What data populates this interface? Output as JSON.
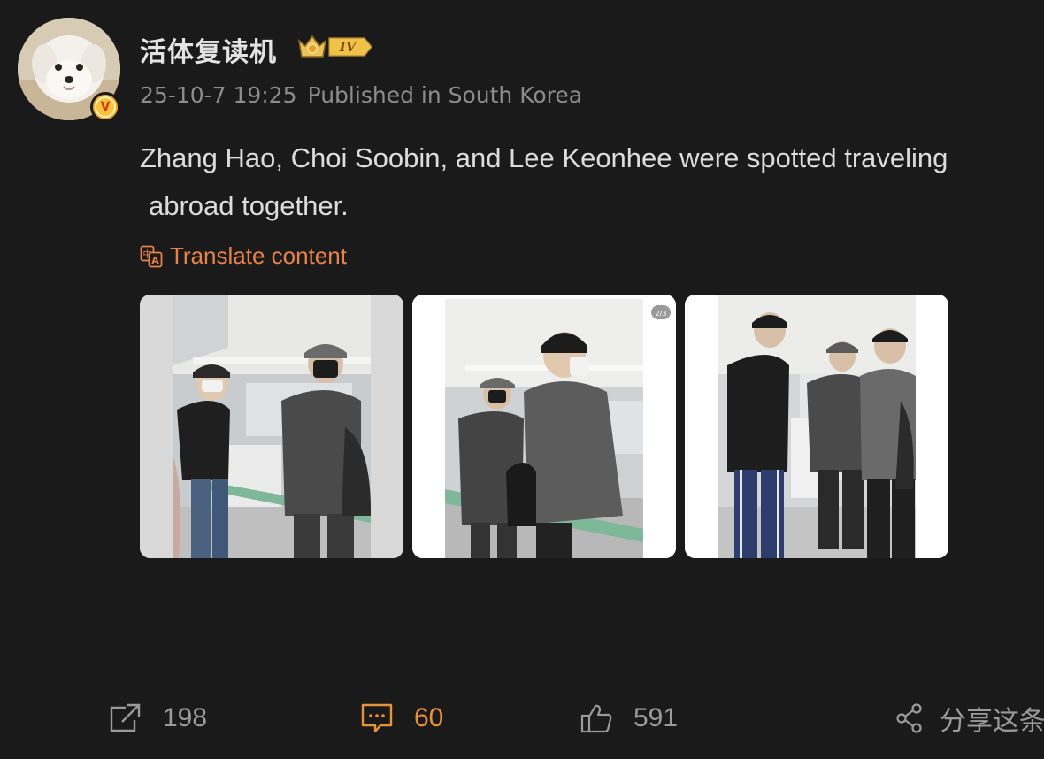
{
  "user": {
    "name": "活体复读机",
    "level_badge": "IV",
    "verified_mark": "V"
  },
  "meta": {
    "timestamp": "25-10-7 19:25",
    "location": "Published in South Korea"
  },
  "post": {
    "text_line1": "Zhang Hao, Choi Soobin, and Lee Keonhee were spotted traveling",
    "text_line2": "abroad together."
  },
  "translate": {
    "label": "Translate content",
    "icon": "translate-icon"
  },
  "photos": [
    {
      "icon": "photo-airport-1"
    },
    {
      "icon": "photo-airport-2",
      "counter": "2/3"
    },
    {
      "icon": "photo-airport-3"
    }
  ],
  "actions": {
    "repost_count": "198",
    "comment_count": "60",
    "like_count": "591",
    "more_label": "分享这条"
  },
  "colors": {
    "background": "#1a1a1a",
    "accent_orange": "#e8834a",
    "comment_active": "#e8923a",
    "muted_text": "#8c8c8c"
  }
}
